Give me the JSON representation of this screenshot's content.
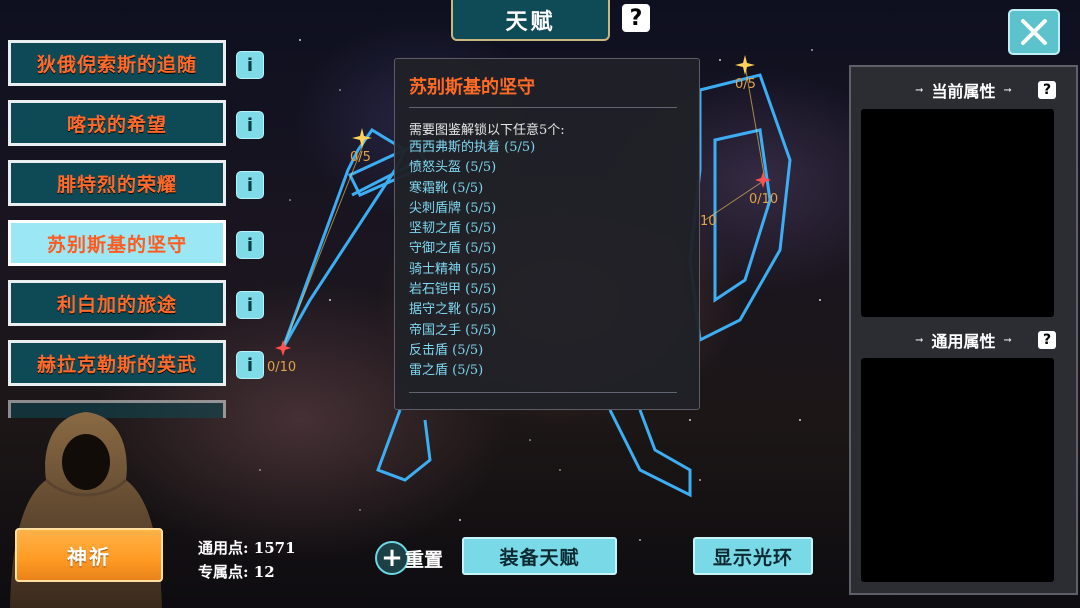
{
  "header": {
    "title": "天赋",
    "help_label": "?"
  },
  "talents": [
    {
      "label": "狄俄倪索斯的追随",
      "info": "i"
    },
    {
      "label": "喀戎的希望",
      "info": "i"
    },
    {
      "label": "腓特烈的荣耀",
      "info": "i"
    },
    {
      "label": "苏别斯基的坚守",
      "info": "i"
    },
    {
      "label": "利白加的旅途",
      "info": "i"
    },
    {
      "label": "赫拉克勒斯的英武",
      "info": "i"
    }
  ],
  "constellation": {
    "nodes": [
      {
        "label": "0/5"
      },
      {
        "label": "0/10"
      },
      {
        "label": "0/5"
      },
      {
        "label": "0/10"
      },
      {
        "label": "10"
      }
    ]
  },
  "tooltip": {
    "title": "苏别斯基的坚守",
    "requirement": "需要图鉴解锁以下任意5个:",
    "items": [
      "西西弗斯的执着 (5/5)",
      "愤怒头盔 (5/5)",
      "寒霜靴 (5/5)",
      "尖刺盾牌 (5/5)",
      "坚韧之盾 (5/5)",
      "守御之盾 (5/5)",
      "骑士精神 (5/5)",
      "岩石铠甲 (5/5)",
      "据守之靴 (5/5)",
      "帝国之手 (5/5)",
      "反击盾 (5/5)",
      "雷之盾 (5/5)"
    ]
  },
  "right_panel": {
    "current_attr_label": "当前属性",
    "common_attr_label": "通用属性",
    "help_label": "?"
  },
  "bottom": {
    "pray_label": "神祈",
    "common_points": "通用点: 1571",
    "exclusive_points": "专属点: 12",
    "reset_label": "重置",
    "reset_icon": "+",
    "equip_label": "装备天赋",
    "show_aura_label": "显示光环"
  },
  "colors": {
    "accent_orange": "#ff6a2a",
    "teal_button": "#0e4a55",
    "cyan_button": "#7ad9e6",
    "constellation_blue": "#3fb6ff"
  }
}
